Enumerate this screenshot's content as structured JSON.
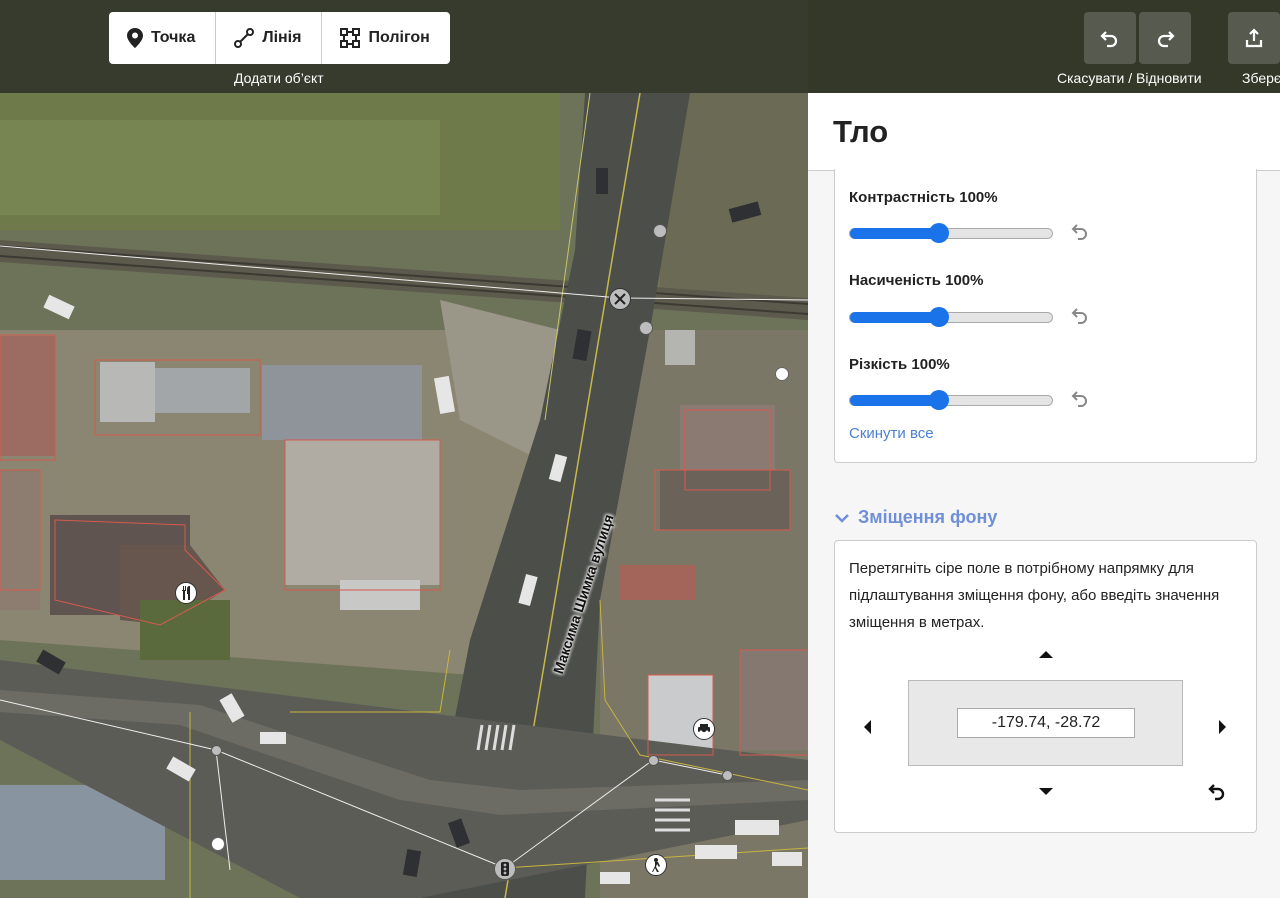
{
  "toolbar": {
    "add_point_label": "Точка",
    "add_line_label": "Лінія",
    "add_polygon_label": "Полігон",
    "add_caption": "Додати об’єкт",
    "undo_redo_caption": "Скасувати / Відновити",
    "save_caption": "Зберє"
  },
  "map": {
    "street_name": "Максима Шимка вулиця"
  },
  "panel": {
    "title": "Тло",
    "sliders": [
      {
        "label": "Контрастність",
        "value": "100%",
        "fraction": 0.44
      },
      {
        "label": "Насиченість",
        "value": "100%",
        "fraction": 0.44
      },
      {
        "label": "Різкість",
        "value": "100%",
        "fraction": 0.44
      }
    ],
    "reset_all_label": "Скинути все",
    "offset_section_title": "Зміщення фону",
    "offset_description": "Перетягніть сіре поле в потрібному напрямку для підлаштування зміщення фону, або введіть значення зміщення в метрах.",
    "offset_value": "-179.74, -28.72"
  },
  "colors": {
    "accent": "#1a73e8",
    "link": "#4a7fd4",
    "section_title": "#6f8fd9"
  }
}
